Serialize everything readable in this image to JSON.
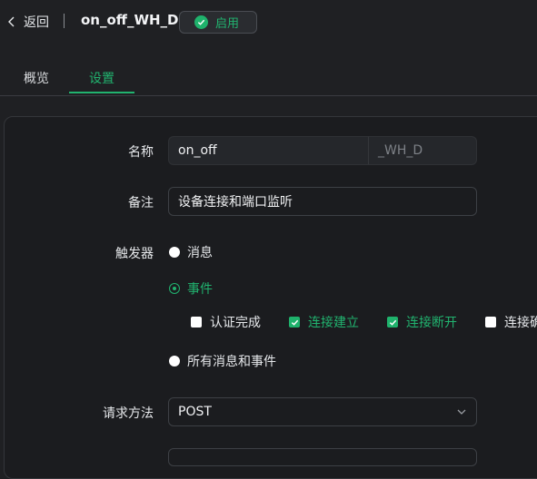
{
  "header": {
    "back_label": "返回",
    "title": "on_off_WH_D",
    "status_label": "启用",
    "status_color": "#21b36f"
  },
  "tabs": [
    {
      "label": "概览",
      "active": false
    },
    {
      "label": "设置",
      "active": true
    }
  ],
  "form": {
    "name": {
      "label": "名称",
      "value": "on_off",
      "suffix": "_WH_D"
    },
    "remark": {
      "label": "备注",
      "value": "设备连接和端口监听"
    },
    "trigger": {
      "label": "触发器",
      "options": [
        {
          "label": "消息",
          "selected": false
        },
        {
          "label": "事件",
          "selected": true
        },
        {
          "label": "所有消息和事件",
          "selected": false
        }
      ],
      "events": [
        {
          "label": "认证完成",
          "checked": false
        },
        {
          "label": "连接建立",
          "checked": true
        },
        {
          "label": "连接断开",
          "checked": true
        },
        {
          "label": "连接确",
          "checked": false
        }
      ]
    },
    "method": {
      "label": "请求方法",
      "value": "POST"
    }
  },
  "icons": {
    "back": "chevron-left-icon",
    "status": "check-circle-icon",
    "select": "chevron-down-icon"
  },
  "colors": {
    "accent": "#21b36f",
    "background": "#1f2023"
  }
}
